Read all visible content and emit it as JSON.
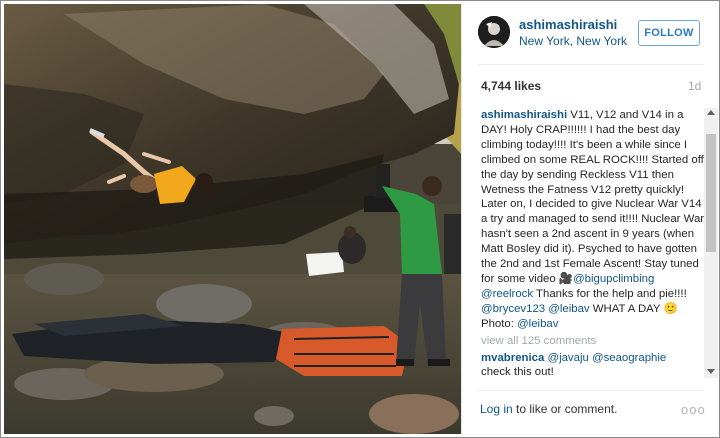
{
  "user": {
    "username": "ashimashiraishi",
    "location": "New York, New York",
    "follow_label": "FOLLOW"
  },
  "post": {
    "likes": "4,744 likes",
    "age": "1d"
  },
  "caption": {
    "author": "ashimashiraishi",
    "text": " V11, V12 and V14 in a DAY! Holy CRAP!!!!!! I had the best day climbing today!!!! It's been a while since I climbed on some REAL ROCK!!!! Started off the day by sending Reckless V11 then Wetness the Fatness V12 pretty quickly! Later on, I decided to give Nuclear War V14 a try and managed to send it!!!! Nuclear War hasn't seen a 2nd ascent in 9 years (when Matt Bosley did it). Psyched to have gotten the 2nd and 1st Female Ascent! Stay tuned for some video ",
    "video_icon": "🎥",
    "mention1": "@bigupclimbing",
    "mention2": "@reelrock",
    "text2": " Thanks for the help and pie!!!! ",
    "mention3": "@brycev123",
    "mention4": "@leibav",
    "text3": " WHAT A DAY ",
    "emoji": "🙂",
    "text4": " Photo: ",
    "mention5": "@leibav"
  },
  "view_all": "view all 125 comments",
  "comment": {
    "author": "mvabrenica",
    "mention1": "@javaju",
    "mention2": "@seaographie",
    "text": "check this out!"
  },
  "footer": {
    "login_link": "Log in",
    "login_text": " to like or comment.",
    "more_icon": "more-dots-icon",
    "more_glyph": "ooo"
  },
  "colors": {
    "link": "#125688",
    "follow_border": "#6fa7d3",
    "muted": "#a5a7aa"
  }
}
